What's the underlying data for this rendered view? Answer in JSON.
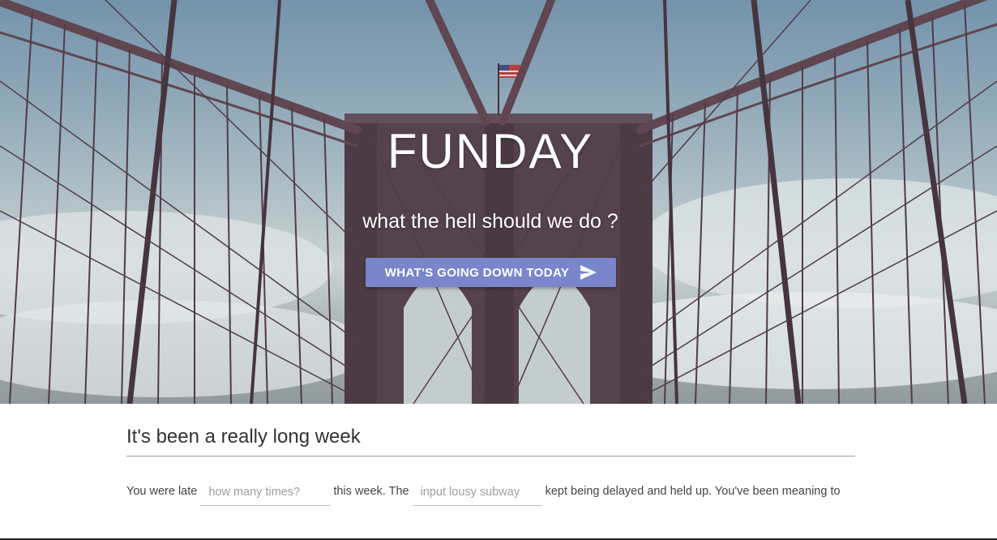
{
  "hero": {
    "title": "FUNDAY",
    "subtitle": "what the hell should we do ?",
    "cta_label": "WHAT'S GOING DOWN TODAY",
    "cta_icon": "send-icon",
    "cta_color": "#7986cb",
    "photo_subject": "Brooklyn Bridge suspension cables and stone tower with flag"
  },
  "section": {
    "heading": "It's been a really long week"
  },
  "madlib": {
    "text_1": "You were late",
    "field_1_placeholder": "how many times?",
    "text_2": "this week. The",
    "field_2_placeholder": "input lousy subway",
    "text_3": "kept being delayed and held up. You've been meaning to"
  }
}
